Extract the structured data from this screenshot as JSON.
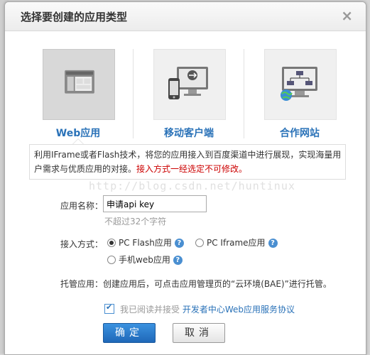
{
  "dialog": {
    "title": "选择要创建的应用类型",
    "close_symbol": "×"
  },
  "app_types": [
    {
      "label": "Web应用",
      "icon": "web-app-icon",
      "selected": true
    },
    {
      "label": "移动客户端",
      "icon": "mobile-client-icon",
      "selected": false
    },
    {
      "label": "合作网站",
      "icon": "partner-site-icon",
      "selected": false
    }
  ],
  "notice": {
    "text": "利用IFrame或者Flash技术，将您的应用接入到百度渠道中进行展现，实现海量用户需求与优质应用的对接。",
    "warning": "接入方式一经选定不可修改。"
  },
  "watermark": "http://blog.csdn.net/huntinux",
  "form": {
    "name_label": "应用名称：",
    "name_value": "申请api key",
    "name_hint": "不超过32个字符",
    "access_label": "接入方式：",
    "access_options": [
      {
        "label": "PC Flash应用",
        "selected": true
      },
      {
        "label": "PC Iframe应用",
        "selected": false
      },
      {
        "label": "手机web应用",
        "selected": false
      }
    ],
    "help_symbol": "?",
    "host_text": "托管应用：创建应用后，可点击应用管理页的“云环境(BAE)”进行托管。",
    "agree_text": "我已阅读并接受",
    "agree_link": "开发者中心Web应用服务协议",
    "agree_checked": true
  },
  "buttons": {
    "ok": "确定",
    "cancel": "取消"
  },
  "colors": {
    "accent": "#2a72b8",
    "warning": "#cc0000",
    "primary_button": "#1f68b8"
  }
}
